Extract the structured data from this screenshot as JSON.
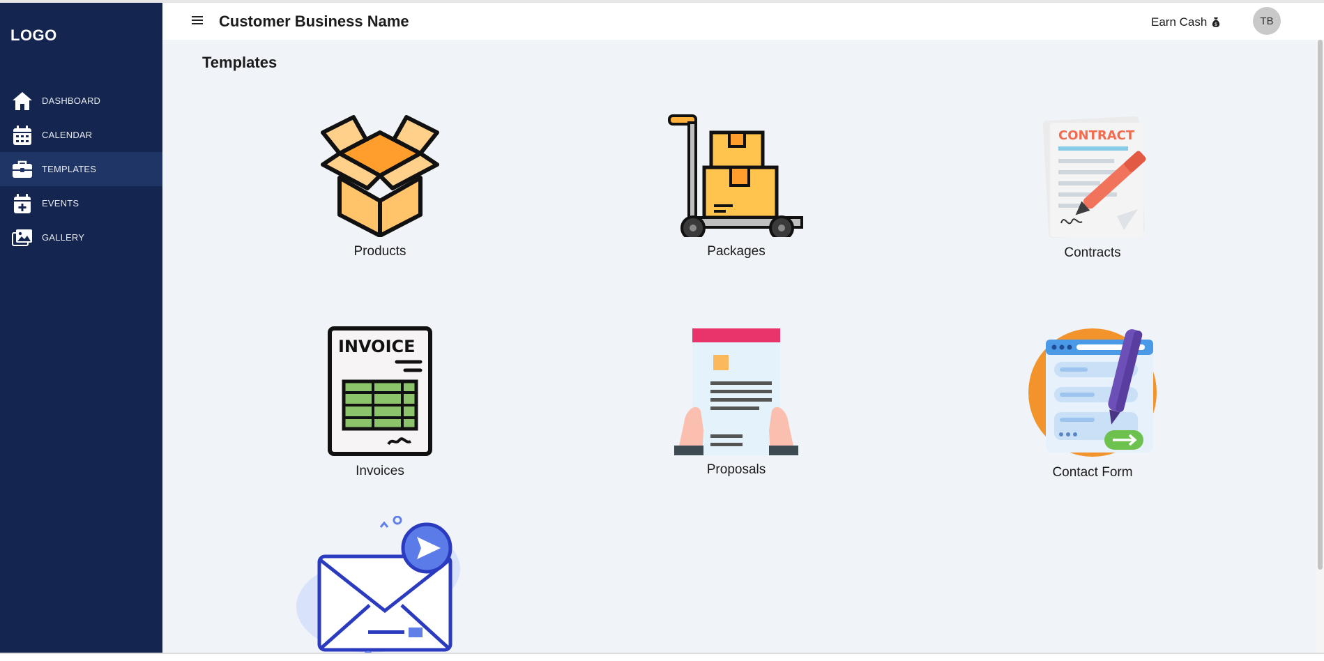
{
  "sidebar": {
    "logo": "LOGO",
    "items": [
      {
        "label": "DASHBOARD",
        "icon": "home-icon",
        "active": false
      },
      {
        "label": "CALENDAR",
        "icon": "calendar-icon",
        "active": false
      },
      {
        "label": "TEMPLATES",
        "icon": "briefcase-icon",
        "active": true
      },
      {
        "label": "EVENTS",
        "icon": "calendar-plus-icon",
        "active": false
      },
      {
        "label": "GALLERY",
        "icon": "gallery-icon",
        "active": false
      }
    ]
  },
  "header": {
    "business_name": "Customer Business Name",
    "earn_cash": "Earn Cash",
    "avatar_initials": "TB"
  },
  "main": {
    "title": "Templates",
    "cards": [
      {
        "label": "Products",
        "icon": "open-box-icon"
      },
      {
        "label": "Packages",
        "icon": "hand-truck-icon"
      },
      {
        "label": "Contracts",
        "icon": "contract-icon"
      },
      {
        "label": "Invoices",
        "icon": "invoice-icon"
      },
      {
        "label": "Proposals",
        "icon": "proposal-icon"
      },
      {
        "label": "Contact Form",
        "icon": "contact-form-icon"
      },
      {
        "label": "",
        "icon": "email-send-icon"
      }
    ]
  },
  "colors": {
    "sidebar_bg": "#14254f",
    "sidebar_active": "#1f3566",
    "main_bg": "#f0f3f8"
  }
}
